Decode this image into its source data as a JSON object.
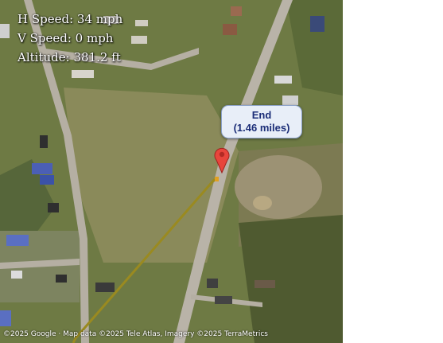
{
  "hud": {
    "h_speed": "H Speed: 34 mph",
    "v_speed": "V Speed: 0 mph",
    "altitude": "Altitude: 381.2 ft"
  },
  "marker": {
    "title": "End",
    "distance": "(1.46 miles)",
    "icon": "map-pin-icon",
    "color": "#e8453c"
  },
  "attribution": "©2025 Google · Map data ©2025 Tele Atlas, Imagery ©2025 TerraMetrics",
  "colors": {
    "route_line": "#9a8a20",
    "road": "#b9b3a8",
    "grass": "#6f7b45"
  }
}
